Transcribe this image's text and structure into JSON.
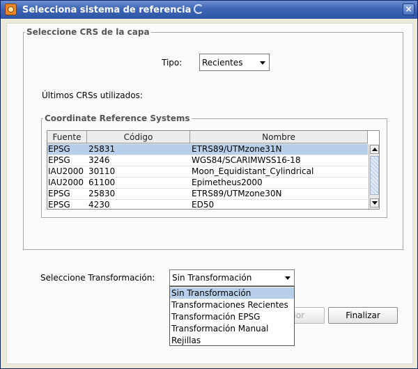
{
  "window": {
    "title": "Selecciona sistema de referencia",
    "close_glyph": "×",
    "icons": {
      "app": "app-logo-icon",
      "close": "close-icon"
    }
  },
  "capa_group": {
    "legend": "Seleccione CRS de la capa",
    "tipo_label": "Tipo:",
    "tipo_value": "Recientes",
    "ultimos_label": "Últimos CRSs utilizados:"
  },
  "crs_group": {
    "legend": "Coordinate Reference Systems",
    "columns": [
      "Fuente",
      "Código",
      "Nombre"
    ],
    "rows": [
      {
        "fuente": "EPSG",
        "codigo": "25831",
        "nombre": "ETRS89/UTMzone31N"
      },
      {
        "fuente": "EPSG",
        "codigo": "3246",
        "nombre": "WGS84/SCARIMWSS16-18"
      },
      {
        "fuente": "IAU2000",
        "codigo": "30110",
        "nombre": "Moon_Equidistant_Cylindrical"
      },
      {
        "fuente": "IAU2000",
        "codigo": "61100",
        "nombre": "Epimetheus2000"
      },
      {
        "fuente": "EPSG",
        "codigo": "25830",
        "nombre": "ETRS89/UTMzone30N"
      },
      {
        "fuente": "EPSG",
        "codigo": "4230",
        "nombre": "ED50"
      }
    ],
    "selected_row": 0
  },
  "transform": {
    "label": "Seleccione Transformación:",
    "value": "Sin Transformación",
    "options": [
      "Sin Transformación",
      "Transformaciones Recientes",
      "Transformación EPSG",
      "Transformación Manual",
      "Rejillas"
    ],
    "selected_option": 0
  },
  "buttons": {
    "anterior_partial": "ior",
    "finalizar": "Finalizar"
  },
  "colors": {
    "titlebar": "#3f66b5",
    "selection": "#b8cfe9",
    "panel": "#fbfbfb"
  }
}
